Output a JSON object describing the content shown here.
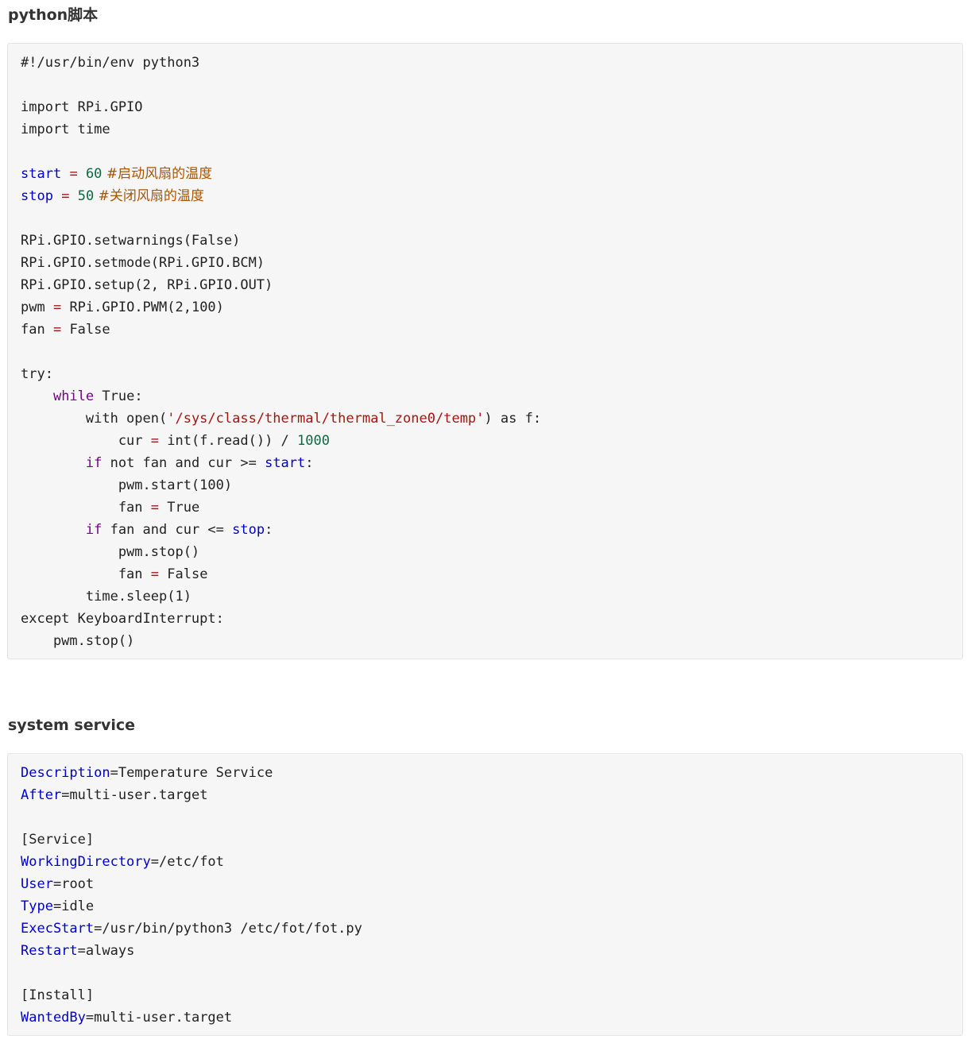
{
  "sections": [
    {
      "heading": "python脚本",
      "lines": [
        [
          {
            "t": "#!/usr/bin/env python3",
            "c": "plain"
          }
        ],
        [],
        [
          {
            "t": "import RPi.GPIO",
            "c": "plain"
          }
        ],
        [
          {
            "t": "import time",
            "c": "plain"
          }
        ],
        [],
        [
          {
            "t": "start",
            "c": "var"
          },
          {
            "t": " ",
            "c": "plain"
          },
          {
            "t": "=",
            "c": "op"
          },
          {
            "t": " ",
            "c": "plain"
          },
          {
            "t": "60",
            "c": "num"
          },
          {
            "t": " #启动风扇的温度",
            "c": "cmt"
          }
        ],
        [
          {
            "t": "stop",
            "c": "var"
          },
          {
            "t": " ",
            "c": "plain"
          },
          {
            "t": "=",
            "c": "op"
          },
          {
            "t": " ",
            "c": "plain"
          },
          {
            "t": "50",
            "c": "num"
          },
          {
            "t": " #关闭风扇的温度",
            "c": "cmt"
          }
        ],
        [],
        [
          {
            "t": "RPi.GPIO.setwarnings(False)",
            "c": "plain"
          }
        ],
        [
          {
            "t": "RPi.GPIO.setmode(RPi.GPIO.BCM)",
            "c": "plain"
          }
        ],
        [
          {
            "t": "RPi.GPIO.setup(2, RPi.GPIO.OUT)",
            "c": "plain"
          }
        ],
        [
          {
            "t": "pwm ",
            "c": "plain"
          },
          {
            "t": "=",
            "c": "op"
          },
          {
            "t": " RPi.GPIO.PWM(2,100)",
            "c": "plain"
          }
        ],
        [
          {
            "t": "fan ",
            "c": "plain"
          },
          {
            "t": "=",
            "c": "op"
          },
          {
            "t": " False",
            "c": "plain"
          }
        ],
        [],
        [
          {
            "t": "try:",
            "c": "plain"
          }
        ],
        [
          {
            "t": "    ",
            "c": "plain"
          },
          {
            "t": "while",
            "c": "kw"
          },
          {
            "t": " True:",
            "c": "plain"
          }
        ],
        [
          {
            "t": "        with open(",
            "c": "plain"
          },
          {
            "t": "'/sys/class/thermal/thermal_zone0/temp'",
            "c": "str"
          },
          {
            "t": ") as f:",
            "c": "plain"
          }
        ],
        [
          {
            "t": "            cur ",
            "c": "plain"
          },
          {
            "t": "=",
            "c": "op"
          },
          {
            "t": " int(f.read()) / ",
            "c": "plain"
          },
          {
            "t": "1000",
            "c": "num"
          }
        ],
        [
          {
            "t": "        ",
            "c": "plain"
          },
          {
            "t": "if",
            "c": "kw"
          },
          {
            "t": " not fan and cur >= ",
            "c": "plain"
          },
          {
            "t": "start",
            "c": "var"
          },
          {
            "t": ":",
            "c": "plain"
          }
        ],
        [
          {
            "t": "            pwm.start(100)",
            "c": "plain"
          }
        ],
        [
          {
            "t": "            fan ",
            "c": "plain"
          },
          {
            "t": "=",
            "c": "op"
          },
          {
            "t": " True",
            "c": "plain"
          }
        ],
        [
          {
            "t": "        ",
            "c": "plain"
          },
          {
            "t": "if",
            "c": "kw"
          },
          {
            "t": " fan and cur <= ",
            "c": "plain"
          },
          {
            "t": "stop",
            "c": "var"
          },
          {
            "t": ":",
            "c": "plain"
          }
        ],
        [
          {
            "t": "            pwm.stop()",
            "c": "plain"
          }
        ],
        [
          {
            "t": "            fan ",
            "c": "plain"
          },
          {
            "t": "=",
            "c": "op"
          },
          {
            "t": " False",
            "c": "plain"
          }
        ],
        [
          {
            "t": "        time.sleep(1)",
            "c": "plain"
          }
        ],
        [
          {
            "t": "except KeyboardInterrupt:",
            "c": "plain"
          }
        ],
        [
          {
            "t": "    pwm.stop()",
            "c": "plain"
          }
        ]
      ]
    },
    {
      "heading": "system service",
      "lines": [
        [
          {
            "t": "Description",
            "c": "key"
          },
          {
            "t": "=",
            "c": "plain"
          },
          {
            "t": "Temperature Service",
            "c": "plain"
          }
        ],
        [
          {
            "t": "After",
            "c": "key"
          },
          {
            "t": "=",
            "c": "plain"
          },
          {
            "t": "multi-user.target",
            "c": "plain"
          }
        ],
        [],
        [
          {
            "t": "[Service]",
            "c": "plain"
          }
        ],
        [
          {
            "t": "WorkingDirectory",
            "c": "key"
          },
          {
            "t": "=",
            "c": "plain"
          },
          {
            "t": "/etc/fot",
            "c": "plain"
          }
        ],
        [
          {
            "t": "User",
            "c": "key"
          },
          {
            "t": "=",
            "c": "plain"
          },
          {
            "t": "root",
            "c": "plain"
          }
        ],
        [
          {
            "t": "Type",
            "c": "key"
          },
          {
            "t": "=",
            "c": "plain"
          },
          {
            "t": "idle",
            "c": "plain"
          }
        ],
        [
          {
            "t": "ExecStart",
            "c": "key"
          },
          {
            "t": "=",
            "c": "plain"
          },
          {
            "t": "/usr/bin/python3 /etc/fot/fot.py",
            "c": "plain"
          }
        ],
        [
          {
            "t": "Restart",
            "c": "key"
          },
          {
            "t": "=",
            "c": "plain"
          },
          {
            "t": "always",
            "c": "plain"
          }
        ],
        [],
        [
          {
            "t": "[Install]",
            "c": "plain"
          }
        ],
        [
          {
            "t": "WantedBy",
            "c": "key"
          },
          {
            "t": "=",
            "c": "plain"
          },
          {
            "t": "multi-user.target",
            "c": "plain"
          }
        ]
      ]
    }
  ]
}
